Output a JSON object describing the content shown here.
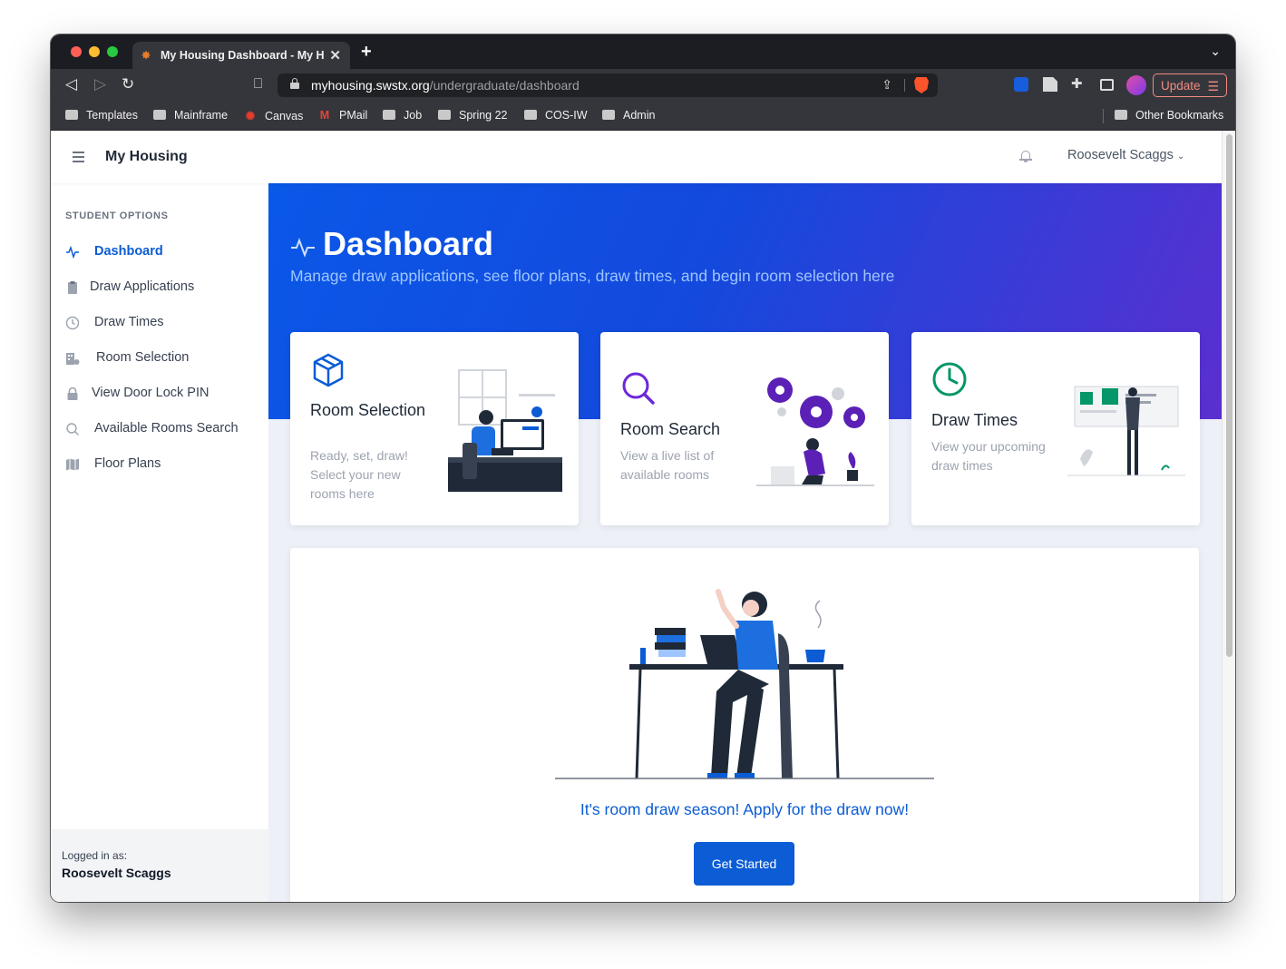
{
  "browser": {
    "tab_title": "My Housing Dashboard - My Housing",
    "tab_close": "✕",
    "new_tab": "+",
    "url_host": "myhousing.swstx.org",
    "url_path": "/undergraduate/dashboard",
    "update_label": "Update",
    "bookmarks": [
      "Templates",
      "Mainframe",
      "Canvas",
      "PMail",
      "Job",
      "Spring 22",
      "COS-IW",
      "Admin"
    ],
    "other_bookmarks": "Other Bookmarks"
  },
  "header": {
    "brand": "My Housing",
    "user_name": "Roosevelt Scaggs"
  },
  "sidebar": {
    "heading": "STUDENT OPTIONS",
    "items": [
      {
        "label": "Dashboard",
        "icon": "activity-icon"
      },
      {
        "label": "Draw Applications",
        "icon": "clipboard-icon"
      },
      {
        "label": "Draw Times",
        "icon": "clock-icon"
      },
      {
        "label": "Room Selection",
        "icon": "building-icon"
      },
      {
        "label": "View Door Lock PIN",
        "icon": "lock-icon"
      },
      {
        "label": "Available Rooms Search",
        "icon": "search-icon"
      },
      {
        "label": "Floor Plans",
        "icon": "map-icon"
      }
    ],
    "logged_label": "Logged in as:",
    "logged_name": "Roosevelt Scaggs"
  },
  "hero": {
    "title": "Dashboard",
    "subtitle": "Manage draw applications, see floor plans, draw times, and begin room selection here"
  },
  "cards": [
    {
      "title": "Room Selection",
      "description": "Ready, set, draw! Select your new rooms here",
      "icon": "box-icon",
      "color": "#0b5cd5"
    },
    {
      "title": "Room Search",
      "description": "View a live list of available rooms",
      "icon": "search-icon",
      "color": "#6d28d9"
    },
    {
      "title": "Draw Times",
      "description": "View your upcoming draw times",
      "icon": "clock-icon",
      "color": "#059669"
    }
  ],
  "cta": {
    "message": "It's room draw season! Apply for the draw now!",
    "button": "Get Started"
  },
  "colors": {
    "primary": "#0b5cd5",
    "hero_gradient_start": "#0a58e8",
    "hero_gradient_end": "#5b2fd0"
  }
}
